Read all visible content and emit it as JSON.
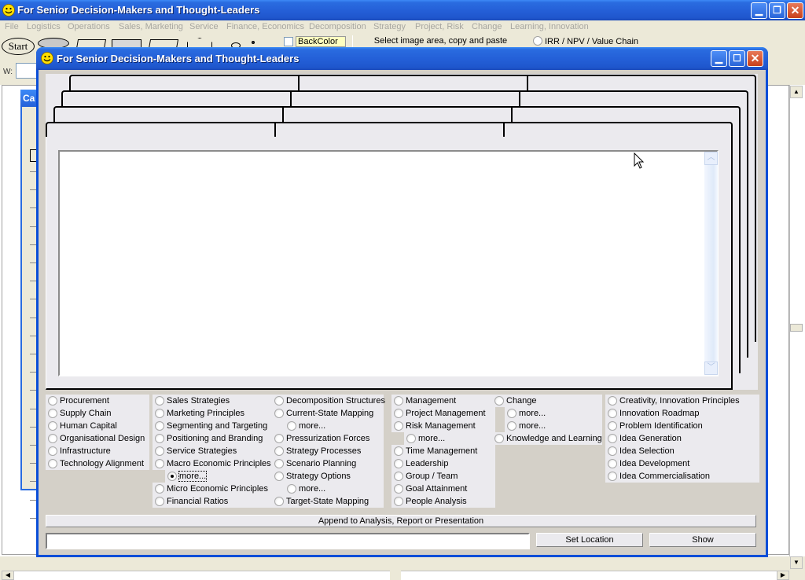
{
  "outer_window": {
    "title": "For Senior Decision-Makers and Thought-Leaders",
    "icon": "smiley-icon",
    "controls": [
      "minimize",
      "restore",
      "close"
    ]
  },
  "menubar": {
    "items": [
      {
        "label": "File"
      },
      {
        "label": "Logistics"
      },
      {
        "label": "Operations"
      },
      {
        "label": "Sales, Marketing"
      },
      {
        "label": "Service"
      },
      {
        "label": "Finance, Economics"
      },
      {
        "label": "Decomposition"
      },
      {
        "label": "Strategy"
      },
      {
        "label": "Project, Risk"
      },
      {
        "label": "Change"
      },
      {
        "label": "Learning, Innovation"
      }
    ]
  },
  "toolbar": {
    "start_label": "Start",
    "backcolor_label": "BackColor",
    "select_area_label": "Select image area, copy and paste",
    "irr_label": "IRR / NPV / Value Chain",
    "w_label": "W:"
  },
  "case_window": {
    "title": "Ca"
  },
  "dialog": {
    "title": "For Senior Decision-Makers and Thought-Leaders",
    "icon": "smiley-icon",
    "controls": [
      "minimize",
      "maximize",
      "close"
    ],
    "textarea_value": "",
    "append_label": "Append to Analysis, Report or Presentation",
    "location_value": "",
    "set_location_label": "Set Location",
    "show_label": "Show"
  },
  "radio_columns": [
    {
      "options": [
        {
          "label": "Procurement",
          "checked": false
        },
        {
          "label": "Supply Chain",
          "checked": false
        },
        {
          "label": "Human Capital",
          "checked": false
        },
        {
          "label": "Organisational Design",
          "checked": false
        },
        {
          "label": "Infrastructure",
          "checked": false
        },
        {
          "label": "Technology Alignment",
          "checked": false
        }
      ]
    },
    {
      "options": [
        {
          "label": "Sales Strategies",
          "checked": false
        },
        {
          "label": "Marketing Principles",
          "checked": false
        },
        {
          "label": "Segmenting and Targeting",
          "checked": false
        },
        {
          "label": "Positioning and Branding",
          "checked": false
        },
        {
          "label": "Service Strategies",
          "checked": false
        },
        {
          "label": "Macro Economic Principles",
          "checked": false
        },
        {
          "label": "more...",
          "checked": true,
          "indent": true
        },
        {
          "label": "Micro Economic Principles",
          "checked": false
        },
        {
          "label": "Financial Ratios",
          "checked": false
        }
      ]
    },
    {
      "options": [
        {
          "label": "Decomposition Structures",
          "checked": false
        },
        {
          "label": "Current-State Mapping",
          "checked": false
        },
        {
          "label": "more...",
          "checked": false,
          "indent": true
        },
        {
          "label": "Pressurization Forces",
          "checked": false
        },
        {
          "label": "Strategy Processes",
          "checked": false
        },
        {
          "label": "Scenario Planning",
          "checked": false
        },
        {
          "label": "Strategy Options",
          "checked": false
        },
        {
          "label": "more...",
          "checked": false,
          "indent": true
        },
        {
          "label": "Target-State Mapping",
          "checked": false
        }
      ]
    },
    {
      "options": [
        {
          "label": "Management",
          "checked": false
        },
        {
          "label": "Project Management",
          "checked": false
        },
        {
          "label": "Risk Management",
          "checked": false
        },
        {
          "label": "more...",
          "checked": false,
          "indent": true
        },
        {
          "label": "Time Management",
          "checked": false
        },
        {
          "label": "Leadership",
          "checked": false
        },
        {
          "label": "Group / Team",
          "checked": false
        },
        {
          "label": "Goal Attainment",
          "checked": false
        },
        {
          "label": "People Analysis",
          "checked": false
        }
      ]
    },
    {
      "options": [
        {
          "label": "Change",
          "checked": false
        },
        {
          "label": "more...",
          "checked": false,
          "indent": true
        },
        {
          "label": "more...",
          "checked": false,
          "indent": true
        },
        {
          "label": "Knowledge and Learning",
          "checked": false
        }
      ]
    },
    {
      "options": [
        {
          "label": "Creativity, Innovation Principles",
          "checked": false
        },
        {
          "label": "Innovation Roadmap",
          "checked": false
        },
        {
          "label": "Problem Identification",
          "checked": false
        },
        {
          "label": "Idea Generation",
          "checked": false
        },
        {
          "label": "Idea Selection",
          "checked": false
        },
        {
          "label": "Idea Development",
          "checked": false
        },
        {
          "label": "Idea Commercialisation",
          "checked": false
        }
      ]
    }
  ]
}
